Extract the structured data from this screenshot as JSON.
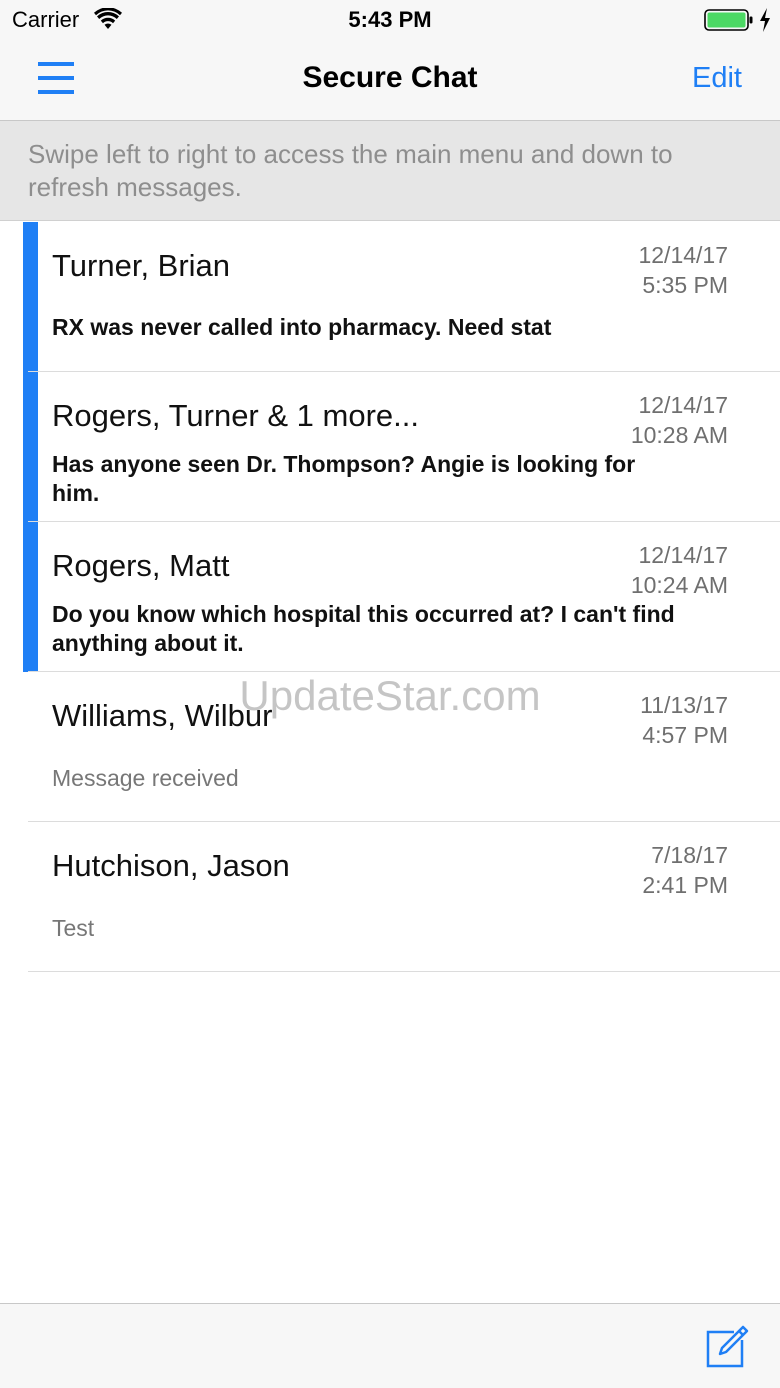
{
  "status_bar": {
    "carrier": "Carrier",
    "time": "5:43 PM",
    "wifi_icon": "wifi-icon",
    "battery_icon": "battery-icon",
    "charging_icon": "charging-bolt-icon",
    "battery_color": "#4cd964"
  },
  "nav_bar": {
    "menu_icon": "hamburger-menu-icon",
    "title": "Secure Chat",
    "edit_label": "Edit"
  },
  "hint": {
    "text": "Swipe left to right to access the main menu and down to refresh messages."
  },
  "chats": [
    {
      "name": "Turner, Brian",
      "date": "12/14/17",
      "time": "5:35 PM",
      "preview": "RX was never called into pharmacy. Need stat",
      "unread": true
    },
    {
      "name": "Rogers, Turner & 1 more...",
      "date": "12/14/17",
      "time": "10:28 AM",
      "preview": "Has anyone seen Dr. Thompson? Angie is looking for him.",
      "unread": true
    },
    {
      "name": "Rogers, Matt",
      "date": "12/14/17",
      "time": "10:24 AM",
      "preview": "Do you know which hospital this occurred at? I can't find anything about it.",
      "unread": true
    },
    {
      "name": "Williams, Wilbur",
      "date": "11/13/17",
      "time": "4:57 PM",
      "preview": "Message received",
      "unread": false
    },
    {
      "name": "Hutchison, Jason",
      "date": "7/18/17",
      "time": "2:41 PM",
      "preview": "Test",
      "unread": false
    }
  ],
  "watermark": "UpdateStar.com",
  "toolbar": {
    "compose_icon": "compose-icon"
  },
  "colors": {
    "accent": "#1f7ff5",
    "bar_background": "#f7f7f7",
    "hint_background": "#e6e6e6"
  }
}
